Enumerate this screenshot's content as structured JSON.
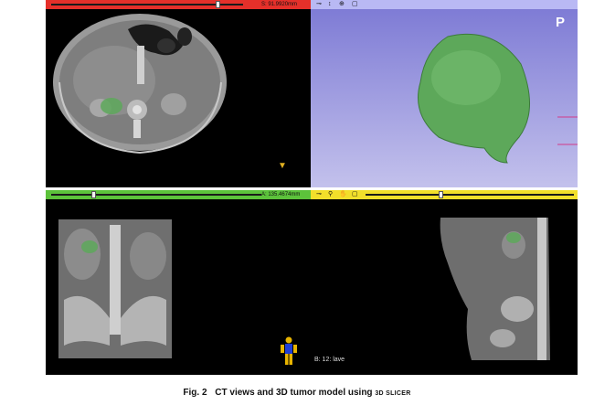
{
  "views": {
    "red": {
      "offset": "S: 91.9920mm",
      "color": "#e5302a"
    },
    "threed": {
      "orientation_label": "P",
      "toolbar_icons": [
        "pin-icon",
        "eye-icon",
        "center-icon",
        "maximize-icon"
      ],
      "color": "#b9b9f4"
    },
    "green": {
      "offset": "A: 135.4674mm",
      "color": "#5cc23b"
    },
    "yellow": {
      "slice_label": "B: 12: lave",
      "toolbar_icons": [
        "pin-icon",
        "link-icon",
        "hand-icon",
        "maximize-icon"
      ],
      "color": "#f2df2a"
    }
  },
  "caption": {
    "label": "Fig. 2",
    "text": "CT views and 3D tumor model using ",
    "software": "3D SLICER"
  },
  "colors": {
    "tumor": "#5da85a",
    "panel_bg": "#000000",
    "threed_bg_top": "#7b78d4",
    "threed_bg_bottom": "#c3c1ec"
  }
}
